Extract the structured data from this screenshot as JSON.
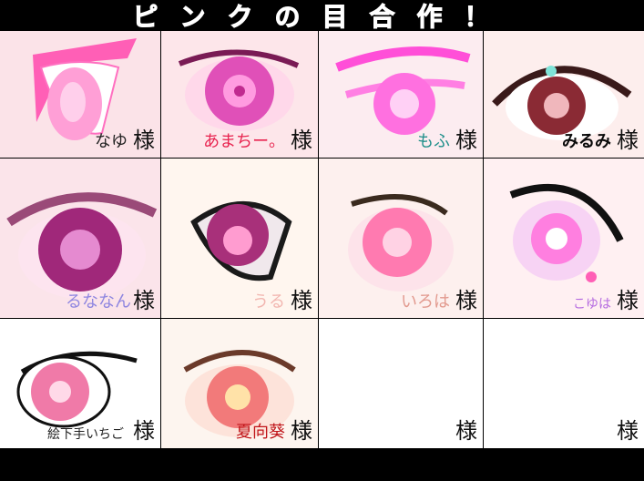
{
  "title": "ピンクの目合作！",
  "honorific": "様",
  "cells": [
    {
      "name": "なゆ",
      "name_color": "#222222",
      "bg": "#fbe3e8"
    },
    {
      "name": "あまちー。",
      "name_color": "#e8234f",
      "bg": "#fde6ea"
    },
    {
      "name": "もふ",
      "name_color": "#1f8f8a",
      "bg": "#fcecf0"
    },
    {
      "name": "みるみ",
      "name_color": "#0a0a0a",
      "bg": "#fdeeed"
    },
    {
      "name": "るななん",
      "name_color": "#8f86e0",
      "bg": "#fbe4ea"
    },
    {
      "name": "うる",
      "name_color": "#f2b6b0",
      "bg": "#fff6ef"
    },
    {
      "name": "いろは",
      "name_color": "#e29a8f",
      "bg": "#fdf0ee"
    },
    {
      "name": "こゆは",
      "name_color": "#b56be0",
      "bg": "#fff0f2"
    },
    {
      "name": "絵下手いちご",
      "name_color": "#222222",
      "bg": "#ffffff"
    },
    {
      "name": "夏向葵",
      "name_color": "#c0151a",
      "bg": "#fdf5ef"
    },
    {
      "name": "",
      "name_color": "#222222",
      "bg": "#ffffff"
    },
    {
      "name": "",
      "name_color": "#222222",
      "bg": "#ffffff"
    }
  ]
}
